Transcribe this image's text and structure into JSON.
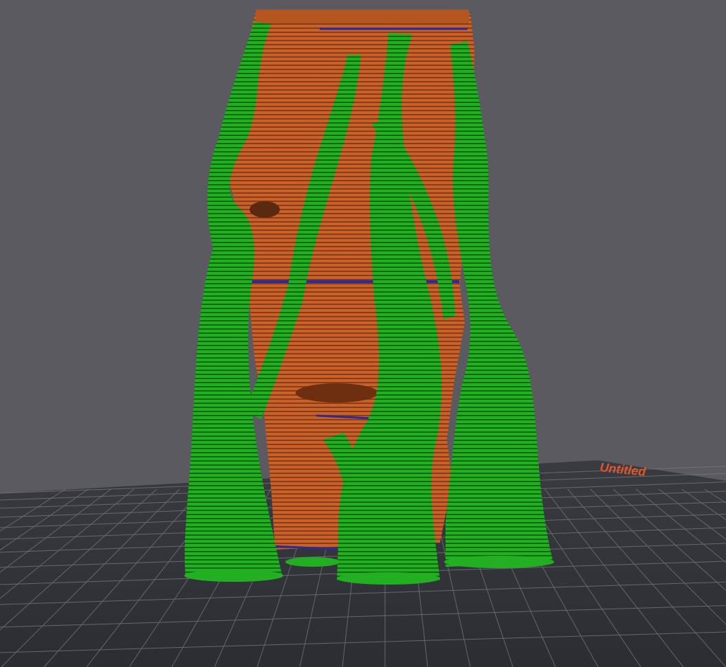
{
  "viewport": {
    "name": "slicer-preview-viewport",
    "background_color": "#5a5a60"
  },
  "build_plate": {
    "label": "Untitled",
    "label_color": "#e2562a",
    "plate_color": "#33343a",
    "grid_color": "#7a7a80"
  },
  "model": {
    "wall_color": "#c8622a",
    "wall_shade_color": "#8a3c17",
    "support_color": "#22b022",
    "support_shade_color": "#0d5f0d",
    "bridge_color": "#2a2a9a"
  }
}
